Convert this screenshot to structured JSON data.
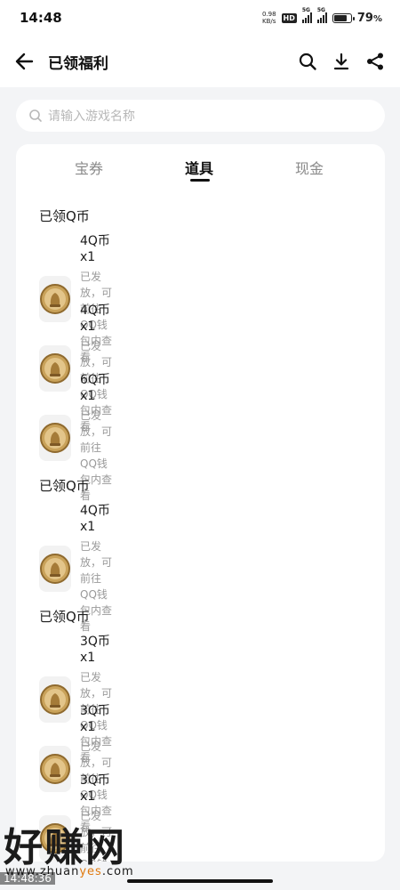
{
  "status_bar": {
    "time": "14:48",
    "net_speed_value": "0.98",
    "net_speed_unit": "KB/s",
    "hd_label": "HD",
    "sim1_label": "5G",
    "sim2_label": "5G",
    "battery_percent": "79",
    "battery_suffix": "%"
  },
  "header": {
    "title": "已领福利",
    "icons": [
      "back-arrow-icon",
      "search-icon",
      "download-icon",
      "share-icon"
    ]
  },
  "search": {
    "placeholder": "请输入游戏名称"
  },
  "tabs": [
    {
      "label": "宝券",
      "active": false
    },
    {
      "label": "道具",
      "active": true
    },
    {
      "label": "现金",
      "active": false
    }
  ],
  "sections": [
    {
      "title": "已领Q币",
      "items": [
        {
          "name": "4Q币x1",
          "desc": "已发放，可前往QQ钱包内查看"
        },
        {
          "name": "4Q币x1",
          "desc": "已发放，可前往QQ钱包内查看"
        },
        {
          "name": "6Q币x1",
          "desc": "已发放，可前往QQ钱包内查看"
        }
      ]
    },
    {
      "title": "已领Q币",
      "items": [
        {
          "name": "4Q币x1",
          "desc": "已发放，可前往QQ钱包内查看"
        }
      ]
    },
    {
      "title": "已领Q币",
      "items": [
        {
          "name": "3Q币x1",
          "desc": "已发放，可前往QQ钱包内查看"
        },
        {
          "name": "3Q币x1",
          "desc": "已发放，可前往QQ钱包内查看"
        },
        {
          "name": "3Q币x1",
          "desc": "已发放，可前往QQ钱包内查看"
        }
      ]
    }
  ],
  "watermark": {
    "brand": "好赚网",
    "url_prefix": "www.zhuan",
    "url_highlight": "yes",
    "url_suffix": ".com",
    "timestamp": "14:48:36"
  },
  "colors": {
    "background": "#f3f4f6",
    "card": "#ffffff",
    "coin_gold": "#c9a25a",
    "accent_watermark": "#e07a10"
  }
}
